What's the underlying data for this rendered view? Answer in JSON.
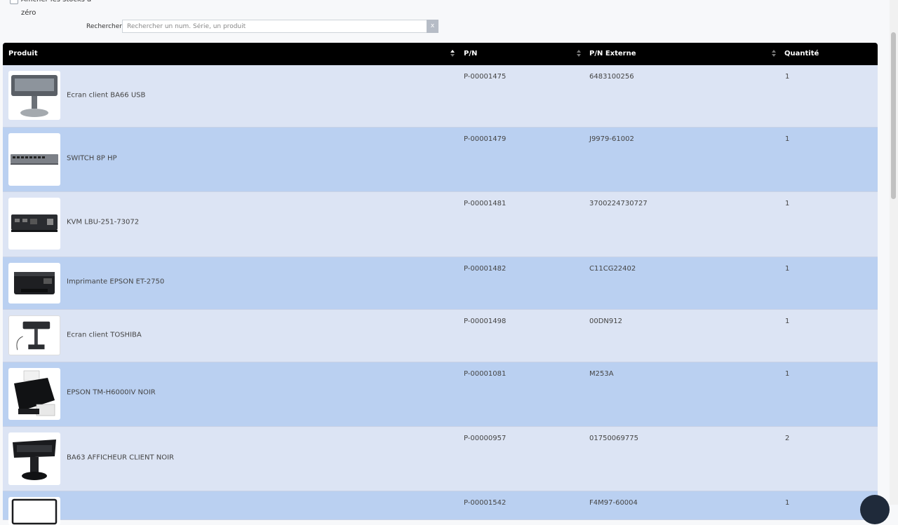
{
  "filters": {
    "show_zero_stock_label": "Afficher les stocks à zéro",
    "search_label": "Rechercher",
    "search_placeholder": "Rechercher un num. Série, un produit",
    "search_value": "",
    "clear_label": "x"
  },
  "table": {
    "columns": [
      "Produit",
      "P/N",
      "P/N Externe",
      "Quantité"
    ],
    "rows": [
      {
        "product": "Ecran client BA66 USB",
        "pn": "P-00001475",
        "pn_ext": "6483100256",
        "qty": "1",
        "image": "pos-display-icon"
      },
      {
        "product": "SWITCH 8P HP",
        "pn": "P-00001479",
        "pn_ext": "J9979-61002",
        "qty": "1",
        "image": "network-switch-icon"
      },
      {
        "product": "KVM LBU-251-73072",
        "pn": "P-00001481",
        "pn_ext": "3700224730727",
        "qty": "1",
        "image": "kvm-switch-icon"
      },
      {
        "product": "Imprimante EPSON ET-2750",
        "pn": "P-00001482",
        "pn_ext": "C11CG22402",
        "qty": "1",
        "image": "printer-icon"
      },
      {
        "product": "Ecran client TOSHIBA",
        "pn": "P-00001498",
        "pn_ext": "00DN912",
        "qty": "1",
        "image": "pole-display-icon"
      },
      {
        "product": "EPSON TM-H6000IV NOIR",
        "pn": "P-00001081",
        "pn_ext": "M253A",
        "qty": "1",
        "image": "receipt-printer-icon"
      },
      {
        "product": "BA63 AFFICHEUR CLIENT NOIR",
        "pn": "P-00000957",
        "pn_ext": "01750069775",
        "qty": "2",
        "image": "customer-display-icon"
      },
      {
        "product": "",
        "pn": "P-00001542",
        "pn_ext": "F4M97-60004",
        "qty": "1",
        "image": "monitor-icon"
      }
    ]
  }
}
